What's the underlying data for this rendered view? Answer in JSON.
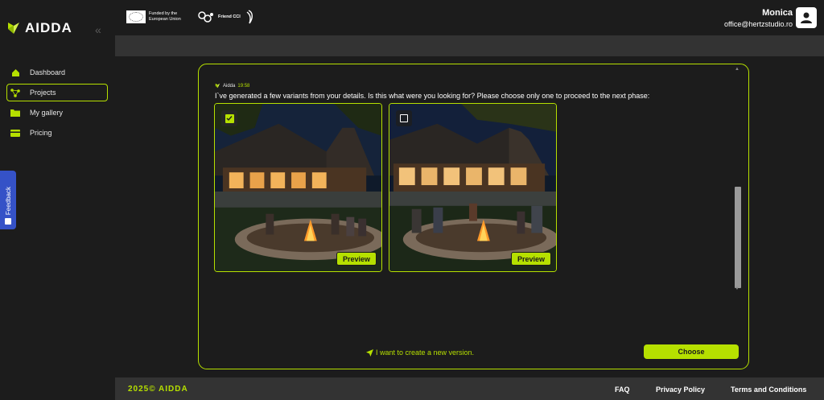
{
  "brand": {
    "name": "AIDDA",
    "accent": "#b6e000"
  },
  "sidebar": {
    "collapse_label": "«",
    "items": [
      {
        "label": "Dashboard",
        "icon": "home-icon"
      },
      {
        "label": "Projects",
        "icon": "projects-icon",
        "active": true
      },
      {
        "label": "My gallery",
        "icon": "folder-icon"
      },
      {
        "label": "Pricing",
        "icon": "card-icon"
      }
    ],
    "feedback_label": "Feedback"
  },
  "header": {
    "eu_text": "Funded by the European Union",
    "friend_text": "Friend CCI",
    "user_name": "Monica",
    "user_email": "office@hertzstudio.ro"
  },
  "chat": {
    "sender": "Aidda",
    "time": "19:58",
    "message": "I`ve generated a few variants from your details. Is this what were you looking for? Please choose only one to proceed to the next phase:",
    "variants": [
      {
        "selected": true,
        "preview_label": "Preview"
      },
      {
        "selected": false,
        "preview_label": "Preview"
      }
    ],
    "new_version_label": "I want to create a new version.",
    "choose_label": "Choose"
  },
  "footer": {
    "copyright": "2025© AIDDA",
    "links": [
      "FAQ",
      "Privacy Policy",
      "Terms and Conditions"
    ]
  }
}
